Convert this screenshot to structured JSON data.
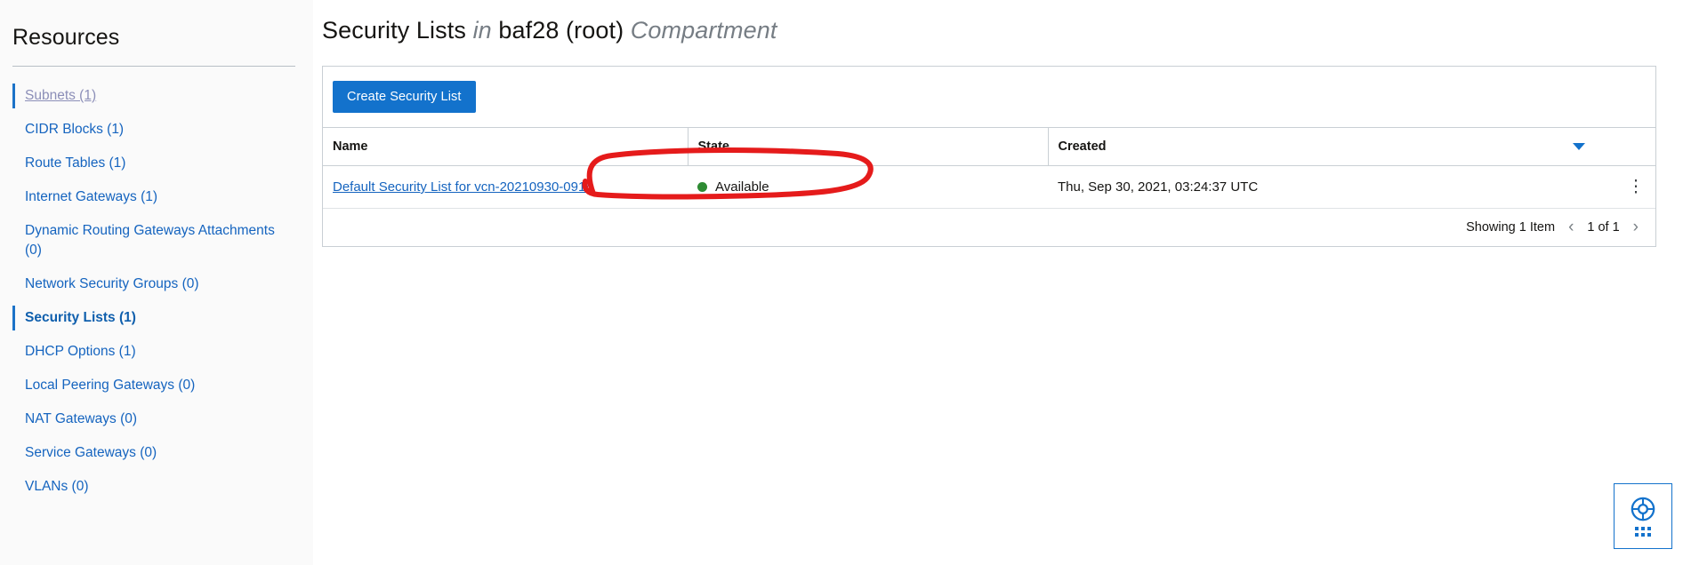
{
  "sidebar": {
    "title": "Resources",
    "items": [
      {
        "label": "Subnets (1)",
        "state": "visited"
      },
      {
        "label": "CIDR Blocks (1)",
        "state": "normal"
      },
      {
        "label": "Route Tables (1)",
        "state": "normal"
      },
      {
        "label": "Internet Gateways (1)",
        "state": "normal"
      },
      {
        "label": "Dynamic Routing Gateways Attachments (0)",
        "state": "normal"
      },
      {
        "label": "Network Security Groups (0)",
        "state": "normal"
      },
      {
        "label": "Security Lists (1)",
        "state": "active"
      },
      {
        "label": "DHCP Options (1)",
        "state": "normal"
      },
      {
        "label": "Local Peering Gateways (0)",
        "state": "normal"
      },
      {
        "label": "NAT Gateways (0)",
        "state": "normal"
      },
      {
        "label": "Service Gateways (0)",
        "state": "normal"
      },
      {
        "label": "VLANs (0)",
        "state": "normal"
      }
    ]
  },
  "header": {
    "title_main": "Security Lists",
    "title_in": "in",
    "title_compartment": "baf28 (root)",
    "title_suffix": "Compartment"
  },
  "toolbar": {
    "create_label": "Create Security List"
  },
  "table": {
    "columns": [
      "Name",
      "State",
      "Created"
    ],
    "rows": [
      {
        "name": "Default Security List for vcn-20210930-0915",
        "state": "Available",
        "state_color": "#2e8b33",
        "created": "Thu, Sep 30, 2021, 03:24:37 UTC",
        "actions_icon": "kebab-menu-icon"
      }
    ],
    "sort_icon": "sort-descending-caret-icon"
  },
  "footer": {
    "showing": "Showing 1 Item",
    "prev_icon": "chevron-left-icon",
    "page_indicator": "1 of 1",
    "next_icon": "chevron-right-icon"
  },
  "help_widget": {
    "icon": "life-preserver-icon",
    "grip_icon": "drag-grip-dots-icon"
  },
  "annotation": {
    "type": "hand-drawn-ellipse",
    "color": "#e51b1b",
    "targets": "Default Security List for vcn-20210930-0915"
  }
}
